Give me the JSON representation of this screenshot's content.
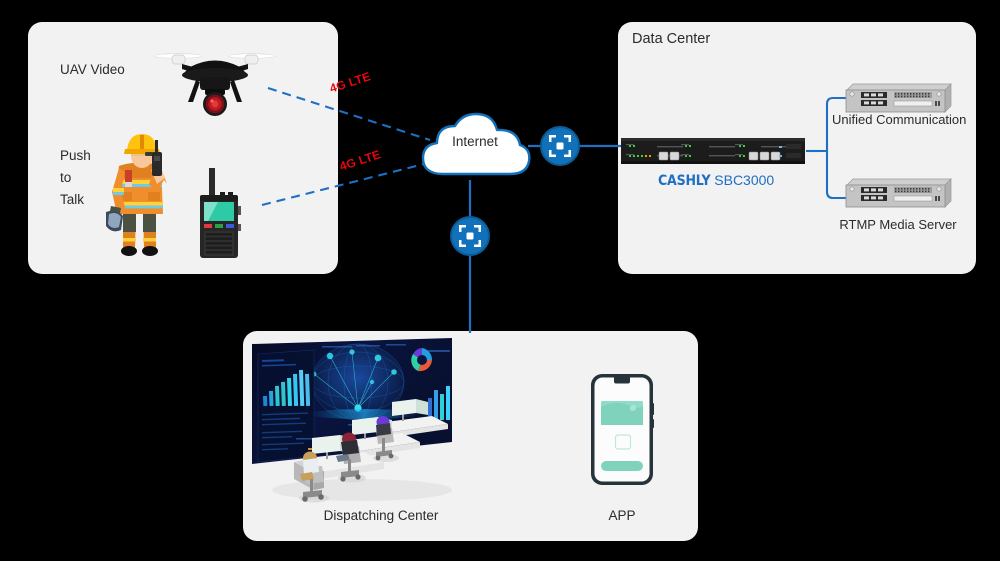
{
  "background_color": "#000000",
  "panel_color": "#f2f2f2",
  "accent_blue": "#1171bb",
  "line_blue": "#1f6fc4",
  "lte_red": "#e8070a",
  "field": {
    "uav_label": "UAV Video",
    "ptt_label_line1": "Push",
    "ptt_label_line2": "to",
    "ptt_label_line3": "Talk",
    "drone_icon": "drone-icon",
    "firefighter_icon": "firefighter-icon",
    "radio_icon": "handheld-radio-icon"
  },
  "links": {
    "lte_uav": "4G LTE",
    "lte_ptt": "4G LTE"
  },
  "cloud": {
    "label": "Internet",
    "icon": "cloud-icon"
  },
  "routers": {
    "to_datacenter": "router-icon",
    "to_dispatch": "router-icon"
  },
  "datacenter": {
    "title": "Data Center",
    "sbc": {
      "brand": "CASHLY",
      "model": "SBC3000",
      "icon": "sbc-appliance-icon"
    },
    "servers": [
      {
        "label": "Unified Communication",
        "icon": "server-icon"
      },
      {
        "label": "RTMP Media Server",
        "icon": "server-icon"
      }
    ]
  },
  "dispatch": {
    "center_label": "Dispatching Center",
    "app_label": "APP",
    "center_icon": "control-room-icon",
    "app_icon": "smartphone-icon"
  }
}
